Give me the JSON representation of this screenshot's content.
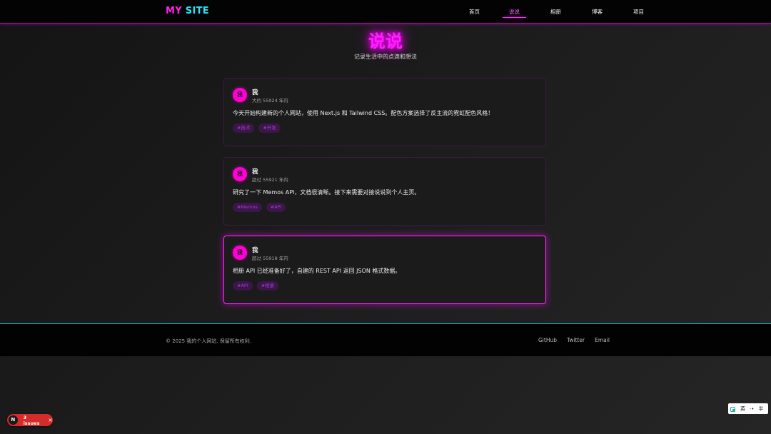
{
  "header": {
    "logo_part1": "MY",
    "logo_part2": " SITE",
    "nav": [
      "首页",
      "说说",
      "相册",
      "博客",
      "项目"
    ],
    "active_nav": "说说"
  },
  "page": {
    "title": "说说",
    "subtitle": "记录生活中的点滴和想法"
  },
  "memos": [
    {
      "avatar": "我",
      "author": "我",
      "time": "大约 55924 年内",
      "content": "今天开始构建新的个人网站，使用 Next.js 和 Tailwind CSS。配色方案选择了反主流的霓虹配色风格！",
      "tags": [
        "#技术",
        "#开发"
      ]
    },
    {
      "avatar": "我",
      "author": "我",
      "time": "超过 55921 年内",
      "content": "研究了一下 Memos API，文档很清晰。接下来需要对接说说到个人主页。",
      "tags": [
        "#Memos",
        "#API"
      ]
    },
    {
      "avatar": "我",
      "author": "我",
      "time": "超过 55918 年内",
      "content": "相册 API 已经准备好了，自建的 REST API 返回 JSON 格式数据。",
      "tags": [
        "#API",
        "#相册"
      ]
    }
  ],
  "footer": {
    "copyright": "© 2025 我的个人网站. 保留所有权利.",
    "links": [
      "GitHub",
      "Twitter",
      "Email"
    ]
  },
  "issues_badge": {
    "letter": "N",
    "label": "3 issues",
    "close": "×"
  },
  "ime": {
    "lang": "英",
    "punct": "·•",
    "width": "半"
  },
  "colors": {
    "neon_pink": "#ff1fff",
    "neon_cyan": "#27e3f5",
    "tag_text": "#a63ad6",
    "tag_bg": "#3a1748",
    "issues_red": "#d42b2b"
  }
}
